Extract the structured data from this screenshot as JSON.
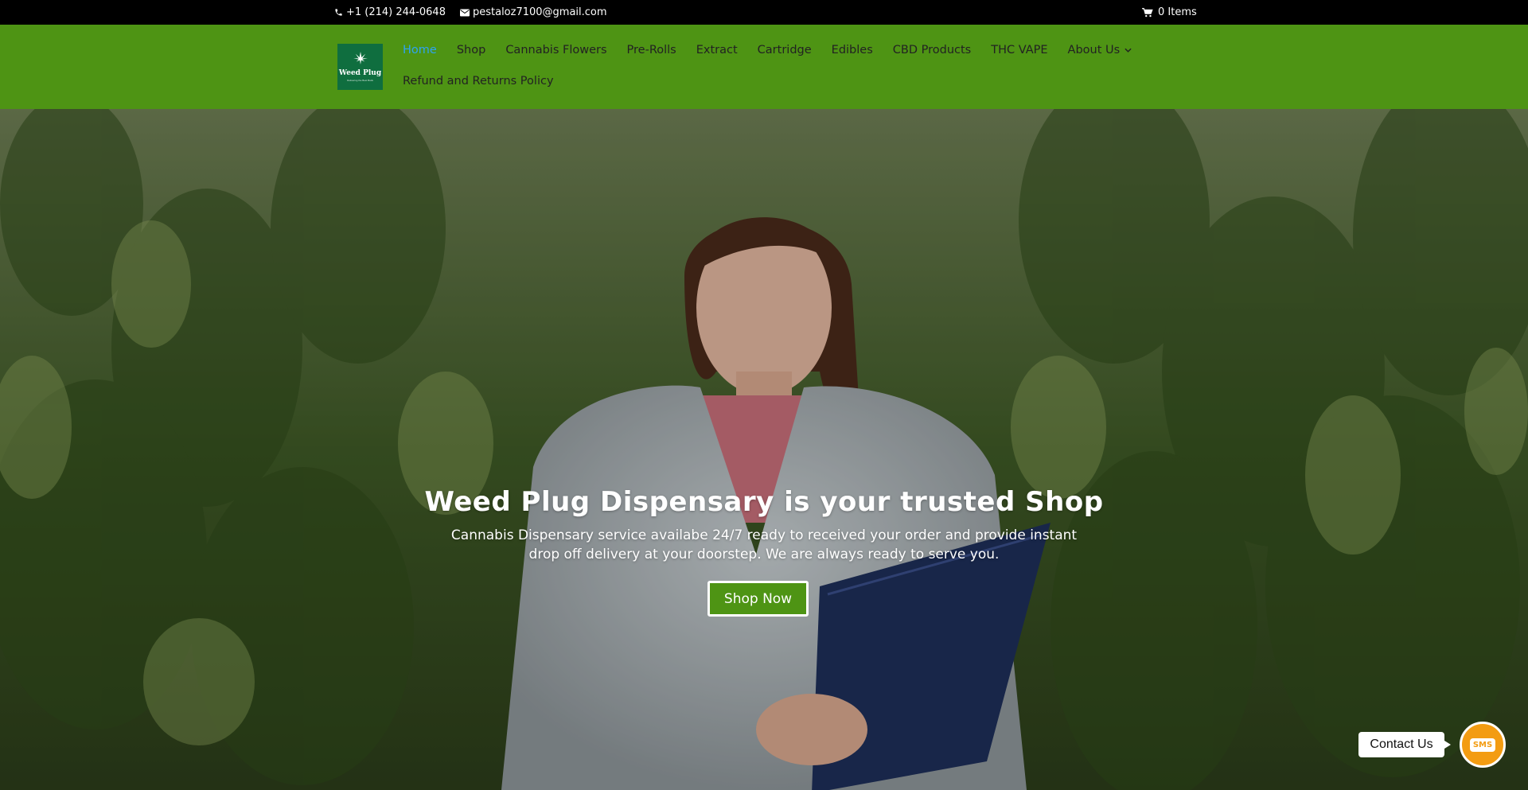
{
  "topbar": {
    "phone": "+1 (214) 244-0648",
    "email": "pestaloz7100@gmail.com",
    "cart": "0 Items"
  },
  "logo": {
    "title": "Weed Plug",
    "subtitle": "Delivering the Best Buds"
  },
  "nav": {
    "row1": [
      "Home",
      "Shop",
      "Cannabis Flowers",
      "Pre-Rolls",
      "Extract",
      "Cartridge",
      "Edibles",
      "CBD Products",
      "THC VAPE",
      "About Us"
    ],
    "row2": [
      "Refund and Returns Policy"
    ],
    "active": "Home"
  },
  "hero": {
    "title": "Weed Plug Dispensary is your trusted Shop",
    "subtitle": "Cannabis Dispensary service availabe 24/7 ready to received your order and provide instant drop off delivery at your doorstep. We are always ready to serve you.",
    "button": "Shop Now"
  },
  "contact": {
    "label": "Contact Us",
    "sms": "SMS"
  },
  "colors": {
    "header": "#4e9414",
    "topbar": "#000000",
    "active_link": "#2ea3f2",
    "sms": "#f39c12"
  }
}
